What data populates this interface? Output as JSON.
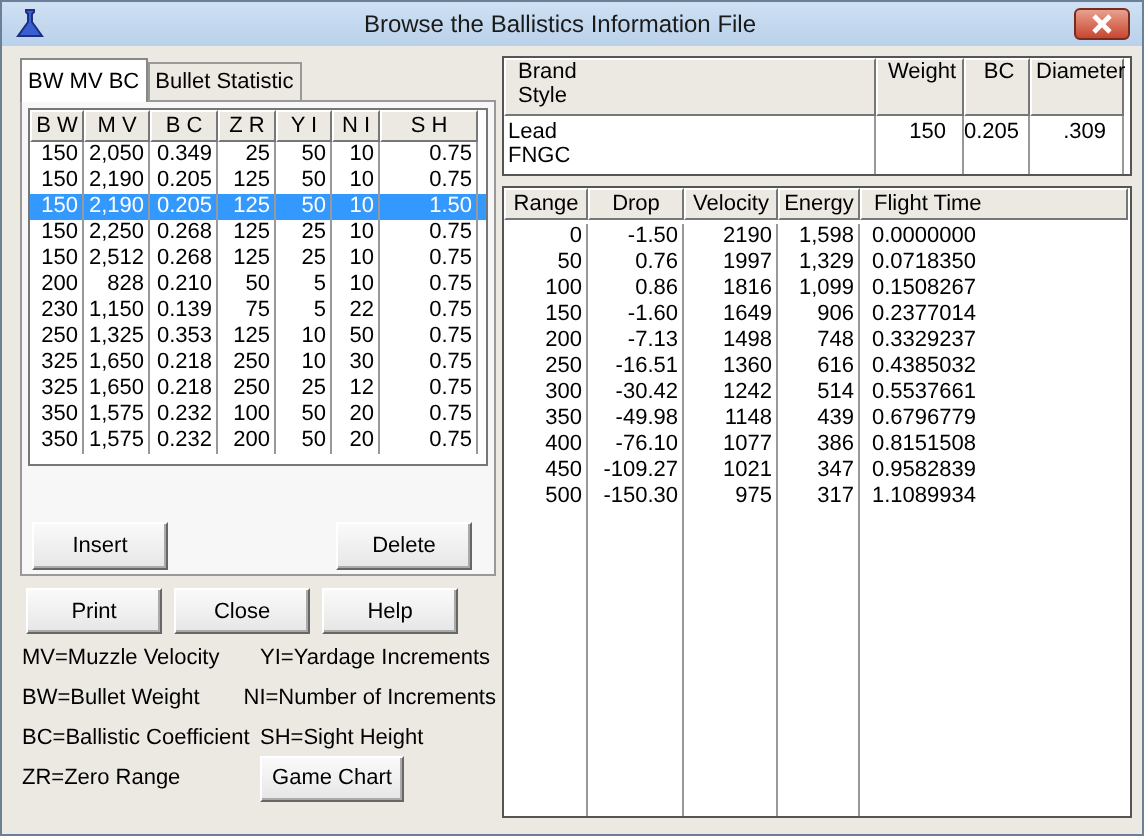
{
  "window": {
    "title": "Browse the Ballistics Information File"
  },
  "tabs": [
    {
      "label": "BW MV BC",
      "selected": true
    },
    {
      "label": "Bullet Statistic",
      "selected": false
    }
  ],
  "bullet_table": {
    "columns": [
      "B W",
      "M V",
      "B C",
      "Z R",
      "Y I",
      "N I",
      "S H"
    ],
    "rows": [
      {
        "cells": [
          "150",
          "2,050",
          "0.349",
          "25",
          "50",
          "10",
          "0.75"
        ],
        "selected": false
      },
      {
        "cells": [
          "150",
          "2,190",
          "0.205",
          "125",
          "50",
          "10",
          "0.75"
        ],
        "selected": false
      },
      {
        "cells": [
          "150",
          "2,190",
          "0.205",
          "125",
          "50",
          "10",
          "1.50"
        ],
        "selected": true
      },
      {
        "cells": [
          "150",
          "2,250",
          "0.268",
          "125",
          "25",
          "10",
          "0.75"
        ],
        "selected": false
      },
      {
        "cells": [
          "150",
          "2,512",
          "0.268",
          "125",
          "25",
          "10",
          "0.75"
        ],
        "selected": false
      },
      {
        "cells": [
          "200",
          "828",
          "0.210",
          "50",
          "5",
          "10",
          "0.75"
        ],
        "selected": false
      },
      {
        "cells": [
          "230",
          "1,150",
          "0.139",
          "75",
          "5",
          "22",
          "0.75"
        ],
        "selected": false
      },
      {
        "cells": [
          "250",
          "1,325",
          "0.353",
          "125",
          "10",
          "50",
          "0.75"
        ],
        "selected": false
      },
      {
        "cells": [
          "325",
          "1,650",
          "0.218",
          "250",
          "10",
          "30",
          "0.75"
        ],
        "selected": false
      },
      {
        "cells": [
          "325",
          "1,650",
          "0.218",
          "250",
          "25",
          "12",
          "0.75"
        ],
        "selected": false
      },
      {
        "cells": [
          "350",
          "1,575",
          "0.232",
          "100",
          "50",
          "20",
          "0.75"
        ],
        "selected": false
      },
      {
        "cells": [
          "350",
          "1,575",
          "0.232",
          "200",
          "50",
          "20",
          "0.75"
        ],
        "selected": false
      }
    ]
  },
  "panel_buttons": [
    "Insert",
    "Delete"
  ],
  "buttons": [
    "Print",
    "Close",
    "Help"
  ],
  "legend": [
    [
      "MV=Muzzle Velocity",
      "YI=Yardage Increments"
    ],
    [
      "BW=Bullet Weight",
      "NI=Number of Increments"
    ],
    [
      "BC=Ballistic Coefficient",
      "SH=Sight Height"
    ],
    [
      "ZR=Zero Range"
    ]
  ],
  "game_chart_button": "Game Chart",
  "bullet_info": {
    "columns": [
      [
        "Brand",
        "Style"
      ],
      [
        "Weight"
      ],
      [
        "BC"
      ],
      [
        "Diameter"
      ]
    ],
    "row": [
      [
        "Lead",
        "FNGC"
      ],
      [
        "150"
      ],
      [
        "0.205"
      ],
      [
        ".309"
      ]
    ]
  },
  "trajectory_table": {
    "columns": [
      "Range",
      "Drop",
      "Velocity",
      "Energy",
      "Flight Time"
    ],
    "rows": [
      [
        "0",
        "-1.50",
        "2190",
        "1,598",
        "0.0000000"
      ],
      [
        "50",
        "0.76",
        "1997",
        "1,329",
        "0.0718350"
      ],
      [
        "100",
        "0.86",
        "1816",
        "1,099",
        "0.1508267"
      ],
      [
        "150",
        "-1.60",
        "1649",
        "906",
        "0.2377014"
      ],
      [
        "200",
        "-7.13",
        "1498",
        "748",
        "0.3329237"
      ],
      [
        "250",
        "-16.51",
        "1360",
        "616",
        "0.4385032"
      ],
      [
        "300",
        "-30.42",
        "1242",
        "514",
        "0.5537661"
      ],
      [
        "350",
        "-49.98",
        "1148",
        "439",
        "0.6796779"
      ],
      [
        "400",
        "-76.10",
        "1077",
        "386",
        "0.8151508"
      ],
      [
        "450",
        "-109.27",
        "1021",
        "347",
        "0.9582839"
      ],
      [
        "500",
        "-150.30",
        "975",
        "317",
        "1.1089934"
      ]
    ]
  }
}
